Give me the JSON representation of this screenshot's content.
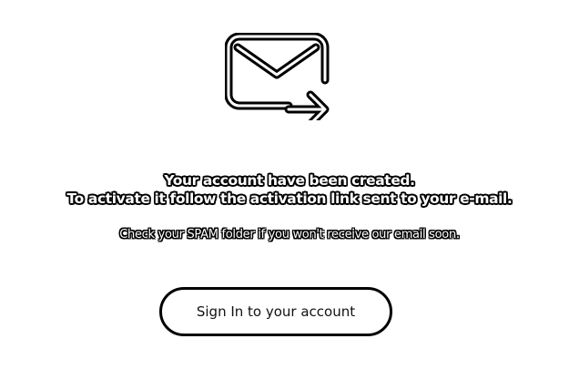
{
  "icon": {
    "name": "mail-forward-icon"
  },
  "message": {
    "line1": "Your account have been created.",
    "line2": "To activate it follow the activation link sent to your e-mail.",
    "spam_note": "Check your SPAM folder if you won't receive our email soon."
  },
  "actions": {
    "signin_label": "Sign In to your account"
  },
  "colors": {
    "background": "#ffffff",
    "ink": "#000000",
    "text_fill": "#ffffff"
  }
}
